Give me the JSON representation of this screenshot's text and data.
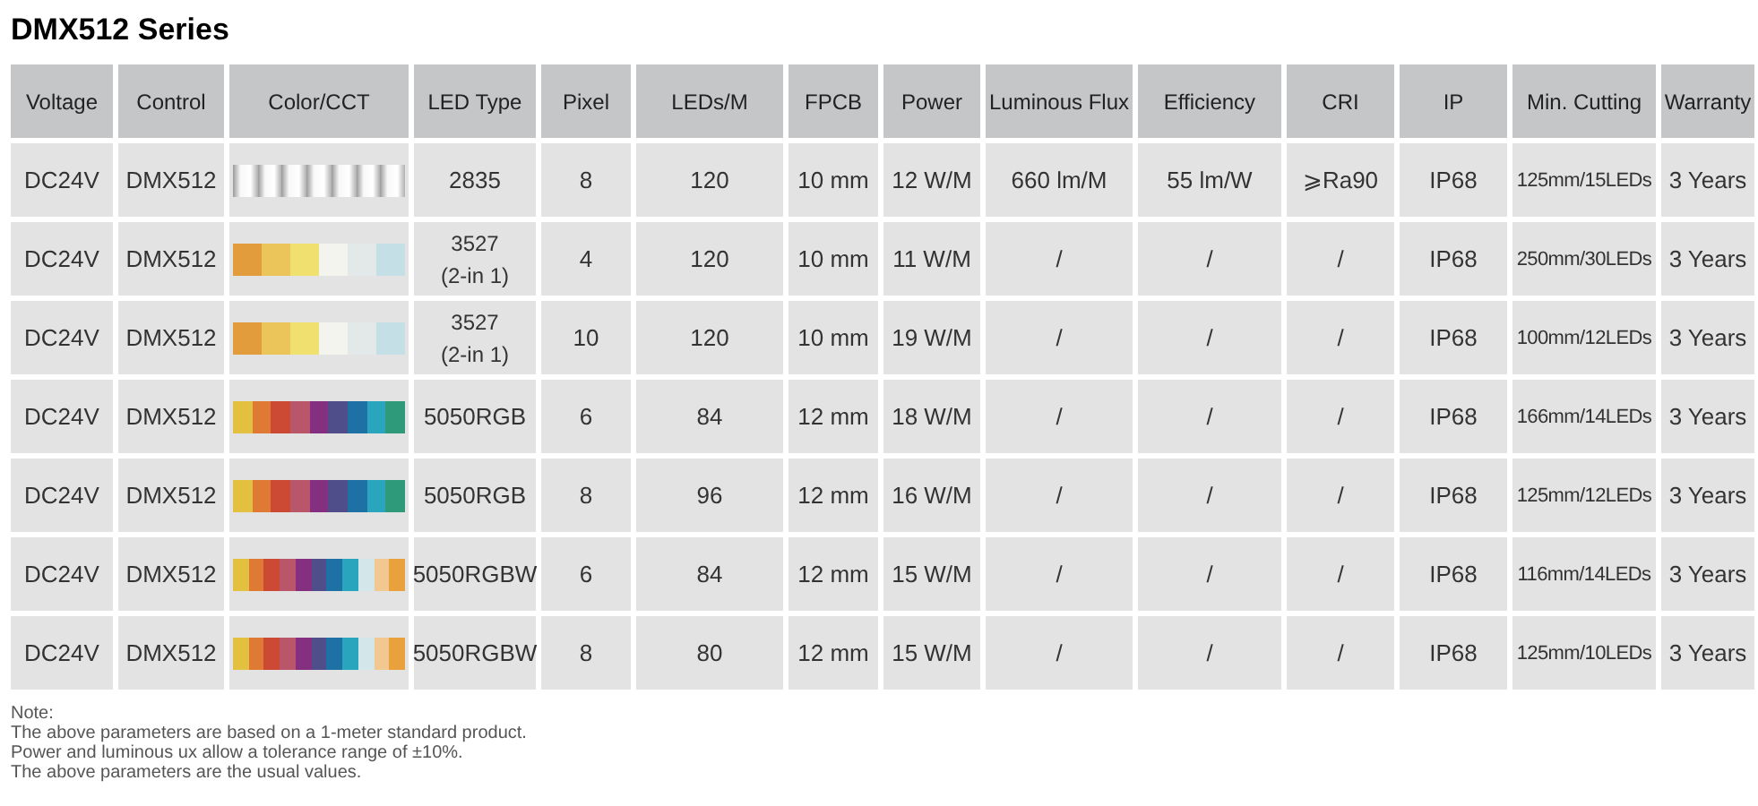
{
  "title": "DMX512 Series",
  "columns": [
    "Voltage",
    "Control",
    "Color/CCT",
    "LED Type",
    "Pixel",
    "LEDs/M",
    "FPCB",
    "Power",
    "Luminous Flux",
    "Efficiency",
    "CRI",
    "IP",
    "Min. Cutting",
    "Warranty"
  ],
  "rows": [
    {
      "kind": "white",
      "cells": [
        "DC24V",
        "DMX512",
        "2835",
        "8",
        "120",
        "10 mm",
        "12 W/M",
        "660 lm/M",
        "55  lm/W",
        "⩾Ra90",
        "IP68",
        "125mm/15LEDs",
        "3 Years"
      ]
    },
    {
      "kind": "cct",
      "cells": [
        "DC24V",
        "DMX512",
        "3527\n(2-in 1)",
        "4",
        "120",
        "10 mm",
        "11 W/M",
        "/",
        "/",
        "/",
        "IP68",
        "250mm/30LEDs",
        "3 Years"
      ]
    },
    {
      "kind": "cct",
      "cells": [
        "DC24V",
        "DMX512",
        "3527\n(2-in 1)",
        "10",
        "120",
        "10 mm",
        "19 W/M",
        "/",
        "/",
        "/",
        "IP68",
        "100mm/12LEDs",
        "3 Years"
      ]
    },
    {
      "kind": "rgb",
      "cells": [
        "DC24V",
        "DMX512",
        "5050RGB",
        "6",
        "84",
        "12 mm",
        "18 W/M",
        "/",
        "/",
        "/",
        "IP68",
        "166mm/14LEDs",
        "3 Years"
      ]
    },
    {
      "kind": "rgb",
      "cells": [
        "DC24V",
        "DMX512",
        "5050RGB",
        "8",
        "96",
        "12 mm",
        "16 W/M",
        "/",
        "/",
        "/",
        "IP68",
        "125mm/12LEDs",
        "3 Years"
      ]
    },
    {
      "kind": "rgbw",
      "cells": [
        "DC24V",
        "DMX512",
        "5050RGBW",
        "6",
        "84",
        "12 mm",
        "15 W/M",
        "/",
        "/",
        "/",
        "IP68",
        "116mm/14LEDs",
        "3 Years"
      ]
    },
    {
      "kind": "rgbw",
      "cells": [
        "DC24V",
        "DMX512",
        "5050RGBW",
        "8",
        "80",
        "12 mm",
        "15 W/M",
        "/",
        "/",
        "/",
        "IP68",
        "125mm/10LEDs",
        "3 Years"
      ]
    }
  ],
  "notes": [
    "Note:",
    "The above parameters are based on a 1-meter standard product.",
    "Power and luminous ux allow a tolerance range of ±10%.",
    "The above parameters are the usual values."
  ]
}
